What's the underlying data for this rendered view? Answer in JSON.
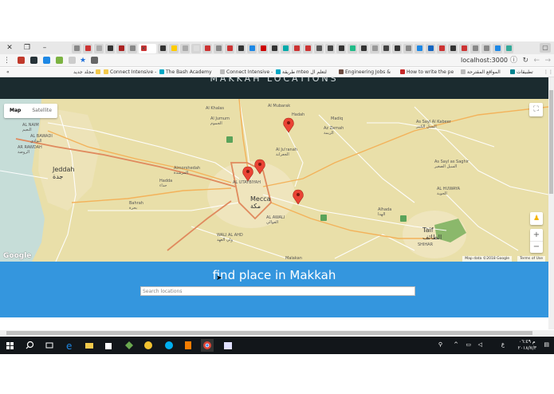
{
  "browser": {
    "url": "localhost:3000",
    "tab_colors": [
      "#888",
      "#c33",
      "#aaa",
      "#333",
      "#a22",
      "#888",
      "#c33",
      "#333",
      "#fc0",
      "#aaa",
      "#ddd",
      "#c33",
      "#888",
      "#c33",
      "#333",
      "#1e88e5",
      "#c00",
      "#333",
      "#0aa",
      "#c33",
      "#c33",
      "#555",
      "#444",
      "#333",
      "#2b8",
      "#333",
      "#999",
      "#444",
      "#333",
      "#888",
      "#1e88e5",
      "#1565c0",
      "#c33",
      "#333",
      "#c33",
      "#888",
      "#888",
      "#1e88e5",
      "#3a9"
    ],
    "bookmarks": [
      "تطبيقات",
      "المواقع المقترحة",
      "How to write the pe",
      "Engineering Jobs &",
      "طريقة mteo لتعلم ال",
      "Connect Intensive -",
      "The Bash Academy",
      "Connect Intensive -",
      "مجلد جديد"
    ]
  },
  "page": {
    "header_title": "MAKKAH LOCATIONS",
    "search_title": "find place in Makkah",
    "search_placeholder": "Search locations"
  },
  "map": {
    "toggle_map": "Map",
    "toggle_satellite": "Satellite",
    "attribution": "Map data ©2018 Google",
    "terms": "Terms of Use",
    "google_logo": "Google",
    "zoom_in": "+",
    "zoom_out": "−",
    "labels": {
      "jeddah": "Jeddah",
      "jeddah_ar": "جدة",
      "mecca": "Mecca",
      "mecca_ar": "مكة",
      "al_mubarak": "Al Mubarak",
      "al_khalas": "Al Khalas",
      "al_jumum": "Al Jumum",
      "al_jumum_ar": "الجموم",
      "madiq": "Madiq",
      "hadah": "Hadah",
      "az_zemah": "Az Zemah",
      "az_zemah_ar": "الزيمة",
      "al_jiranah": "Al Ju'ranah",
      "al_jiranah_ar": "الجعرانة",
      "as_sayl_kabeer": "As Sayl Al Kabeer",
      "as_sayl_kabeer_ar": "السيل الكبير",
      "as_sayl_saghir": "As Sayl as Saghir",
      "as_sayl_saghir_ar": "السيل الصغير",
      "al_huwaya": "AL HUWAYA",
      "al_huwaya_ar": "الحوية",
      "almorshedah": "Almorshedah",
      "almorshedah_ar": "المرشدة",
      "hadda": "Hadda",
      "hadda_ar": "حداء",
      "bahrah": "Bahrah",
      "bahrah_ar": "بحرة",
      "al_utaybiyah": "AL UTAYBIYAH",
      "al_awali": "AL AWALI",
      "al_awali_ar": "العوالي",
      "wali_al_ahd": "WALI AL AHD",
      "wali_al_ahd_ar": "ولي العهد",
      "alhada": "Alhada",
      "alhada_ar": "الهدا",
      "taif": "Taif",
      "taif_ar": "الطائف",
      "shihar": "SHIHAR",
      "al_naim": "AL NAIM",
      "al_naim_ar": "النعيم",
      "al_bawadi": "AL BAWADI",
      "al_bawadi_ar": "البوادي",
      "ar_rawdah": "AR RAWDAH",
      "ar_rawdah_ar": "الروضة",
      "malakan": "Malakan",
      "almahani": "المحاني",
      "road_r1": "15",
      "road_r2": "40",
      "road_r3": "301",
      "road_r4": "305",
      "road_r5": "A404"
    }
  },
  "taskbar": {
    "time": "م ٠٦:٤٩",
    "date": "٢٠١٨/٧/٣",
    "lang": "ع"
  }
}
